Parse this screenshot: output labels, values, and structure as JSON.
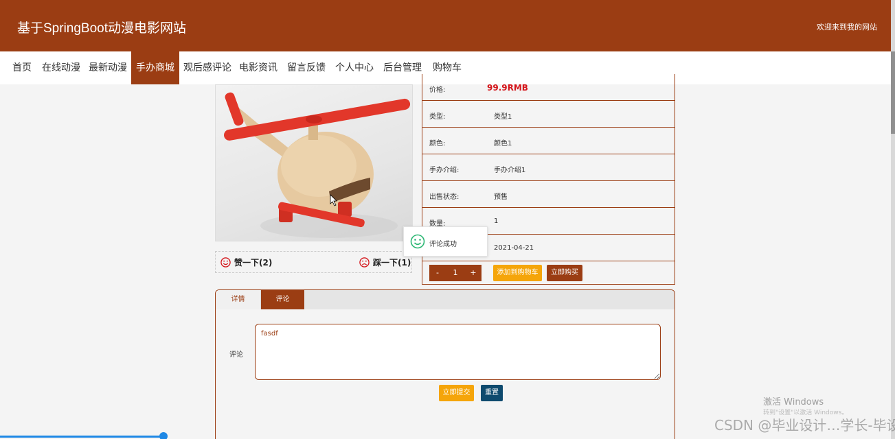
{
  "header": {
    "site_title": "基于SpringBoot动漫电影网站",
    "welcome": "欢迎来到我的网站"
  },
  "nav": {
    "items": [
      "首页",
      "在线动漫",
      "最新动漫",
      "手办商城",
      "观后感评论",
      "电影资讯",
      "留言反馈",
      "个人中心",
      "后台管理",
      "购物车"
    ],
    "active": "手办商城"
  },
  "product": {
    "image_icon": "wooden-toy-helicopter-image",
    "like_label": "赞一下(2)",
    "dislike_label": "踩一下(1)",
    "fields": [
      {
        "label": "价格:",
        "value": "99.9RMB"
      },
      {
        "label": "类型:",
        "value": "类型1"
      },
      {
        "label": "颜色:",
        "value": "颜色1"
      },
      {
        "label": "手办介绍:",
        "value": "手办介绍1"
      },
      {
        "label": "出售状态:",
        "value": "预售"
      },
      {
        "label": "数量:",
        "value": "1"
      },
      {
        "label": "",
        "value": "2021-04-21"
      }
    ],
    "qty_minus": "-",
    "qty_value": "1",
    "qty_plus": "+",
    "add_to_cart": "添加到购物车",
    "buy_now": "立即购买"
  },
  "toast": {
    "icon": "smile-icon",
    "text": "评论成功"
  },
  "tabs": {
    "items": [
      "详情",
      "评论"
    ],
    "active": "评论"
  },
  "comment_form": {
    "label": "评论",
    "value": "fasdf",
    "submit": "立即提交",
    "reset": "重置"
  },
  "watermark": {
    "activate_title": "激活 Windows",
    "activate_hint": "转到\"设置\"以激活 Windows。",
    "csdn": "CSDN @毕业设计…学长-毕设"
  },
  "colors": {
    "brand": "#9b3d13",
    "price": "#d4161b",
    "orange": "#f5a50a",
    "navy": "#0e4a6e",
    "success": "#2bb673"
  }
}
